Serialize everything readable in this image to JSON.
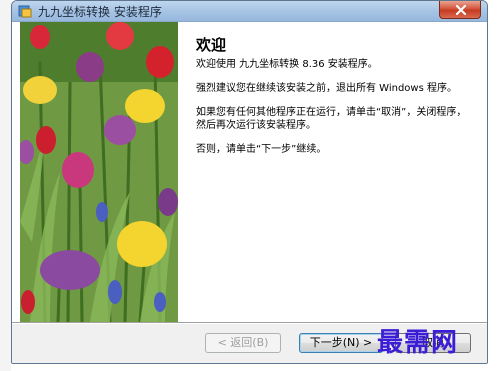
{
  "window": {
    "title": "九九坐标转换 安装程序"
  },
  "welcome": {
    "heading": "欢迎",
    "intro": "欢迎使用 九九坐标转换 8.36 安装程序。",
    "warning": "强烈建议您在继续该安装之前，退出所有 Windows 程序。",
    "running": "如果您有任何其他程序正在运行，请单击“取消”，关闭程序，然后再次运行该安装程序。",
    "otherwise": "否则，请单击“下一步”继续。"
  },
  "buttons": {
    "back": "< 返回(B)",
    "next": "下一步(N) >",
    "cancel": "取消"
  },
  "watermark": "最需网",
  "colors": {
    "watermark": "#3b1dd6",
    "titlebar": "#a7c4e4",
    "close": "#c63b22"
  }
}
